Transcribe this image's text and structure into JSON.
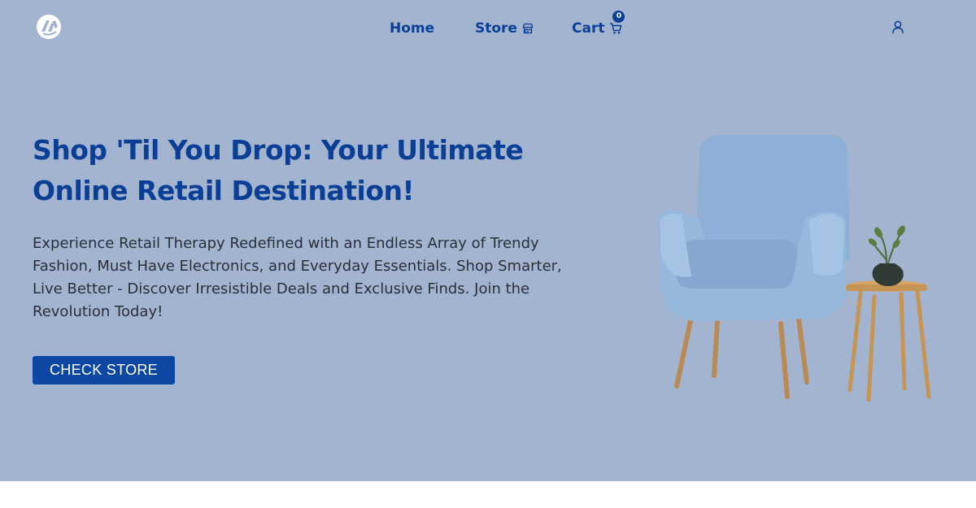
{
  "header": {
    "logo_icon": "brand-logo-icon",
    "nav": {
      "home_label": "Home",
      "store_label": "Store",
      "cart_label": "Cart",
      "cart_count": "0"
    },
    "user_icon": "user-icon"
  },
  "hero": {
    "headline": "Shop 'Til You Drop: Your Ultimate Online Retail Destination!",
    "subtext": "Experience Retail Therapy Redefined with an Endless Array of Trendy Fashion, Must Have Electronics, and Everyday Essentials. Shop Smarter, Live Better - Discover Irresistible Deals and Exclusive Finds. Join the Revolution Today!",
    "cta_label": "CHECK STORE"
  },
  "colors": {
    "hero_background": "#a2b4cf",
    "accent": "#0b3f96",
    "button": "#0b47a3",
    "page_background": "#ffffff"
  }
}
